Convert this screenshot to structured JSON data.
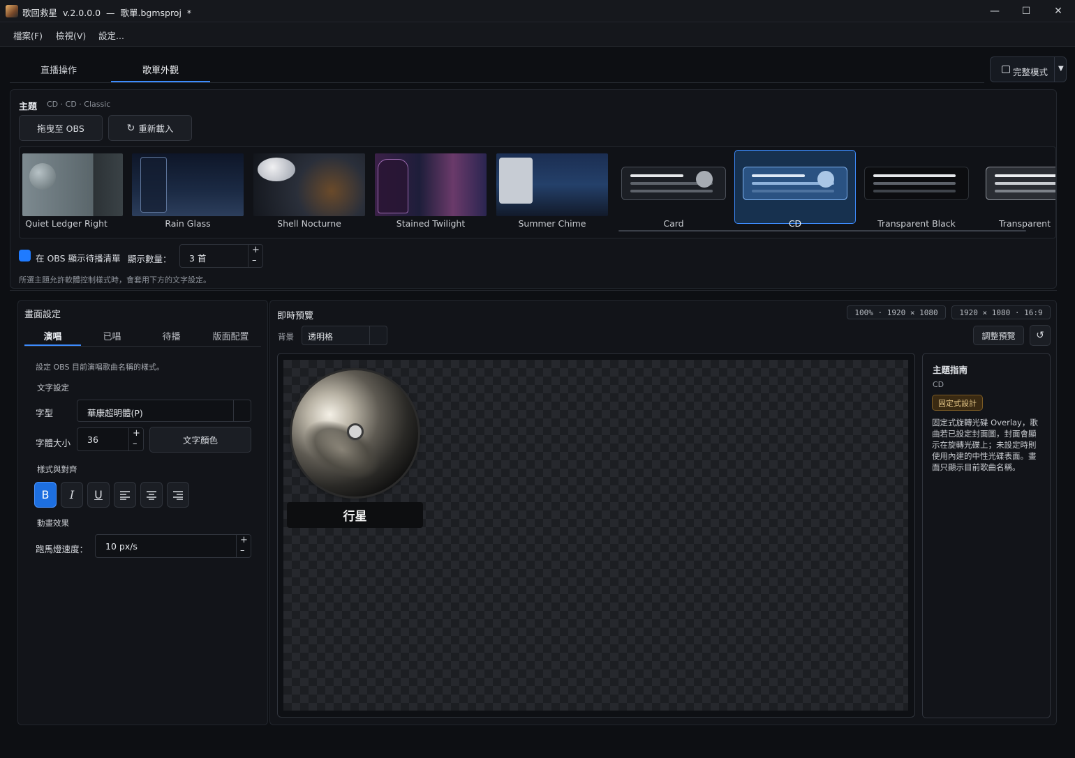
{
  "window": {
    "title": "歌回救星  v.2.0.0.0  —  歌單.bgmsproj  *",
    "minimize": "—",
    "maximize": "☐",
    "close": "✕"
  },
  "menu": [
    "檔案(F)",
    "檢視(V)",
    "設定..."
  ],
  "tabs": [
    {
      "label": "直播操作",
      "active": false
    },
    {
      "label": "歌單外觀",
      "active": true
    }
  ],
  "mode_button": {
    "label": "完整模式",
    "icon": "layout-icon"
  },
  "theme": {
    "label": "主題",
    "current": "CD · CD · Classic",
    "drag_button": "拖曳至 OBS",
    "reload_button": "重新載入",
    "items": [
      {
        "name": "Quiet Ledger Right",
        "color": "#6c7a80"
      },
      {
        "name": "Rain Glass",
        "color": "#1b2a44"
      },
      {
        "name": "Shell Nocturne",
        "color": "#2a2f3a"
      },
      {
        "name": "Stained Twilight",
        "color": "#3a2550"
      },
      {
        "name": "Summer Chime",
        "color": "#1e3354"
      },
      {
        "name": "Card"
      },
      {
        "name": "CD",
        "selected": true
      },
      {
        "name": "Transparent Black"
      },
      {
        "name": "Transparent W"
      }
    ]
  },
  "queue_option": {
    "checkbox_label": "在 OBS 顯示待播清單",
    "checked": true,
    "count_label": "顯示數量：",
    "count_value": "3 首",
    "hint": "所選主題允許軟體控制樣式時，會套用下方的文字設定。"
  },
  "screen_settings": {
    "title": "畫面設定",
    "tabs": [
      "演唱",
      "已唱",
      "待播",
      "版面配置"
    ],
    "active_tab": "演唱",
    "description": "設定 OBS 目前演唱歌曲名稱的樣式。",
    "text_settings_label": "文字設定",
    "font_label": "字型",
    "font_value": "華康超明體(P)",
    "size_label": "字體大小",
    "size_value": "36",
    "color_button": "文字顏色",
    "style_label": "樣式與對齊",
    "animation_label": "動畫效果",
    "marquee_label": "跑馬燈速度：",
    "marquee_value": "10 px/s",
    "bold_active": true
  },
  "preview": {
    "title": "即時預覽",
    "pill_zoom": "100%  ·  1920 × 1080",
    "pill_ratio": "1920 × 1080  ·  16:9",
    "bg_label": "背景",
    "bg_value": "透明格",
    "adjust_button": "調整預覽",
    "song_title": "行星"
  },
  "guide": {
    "title": "主題指南",
    "subtitle": "CD",
    "badge": "固定式設計",
    "body": "固定式旋轉光碟 Overlay，歌曲若已設定封面圖，封面會顯示在旋轉光碟上；未設定時則使用內建的中性光碟表面。畫面只顯示目前歌曲名稱。"
  },
  "colors": {
    "accent": "#3d8bfd",
    "badge_bg": "#3a2a12",
    "badge_border": "#7a5a24",
    "badge_text": "#e8c98a"
  }
}
